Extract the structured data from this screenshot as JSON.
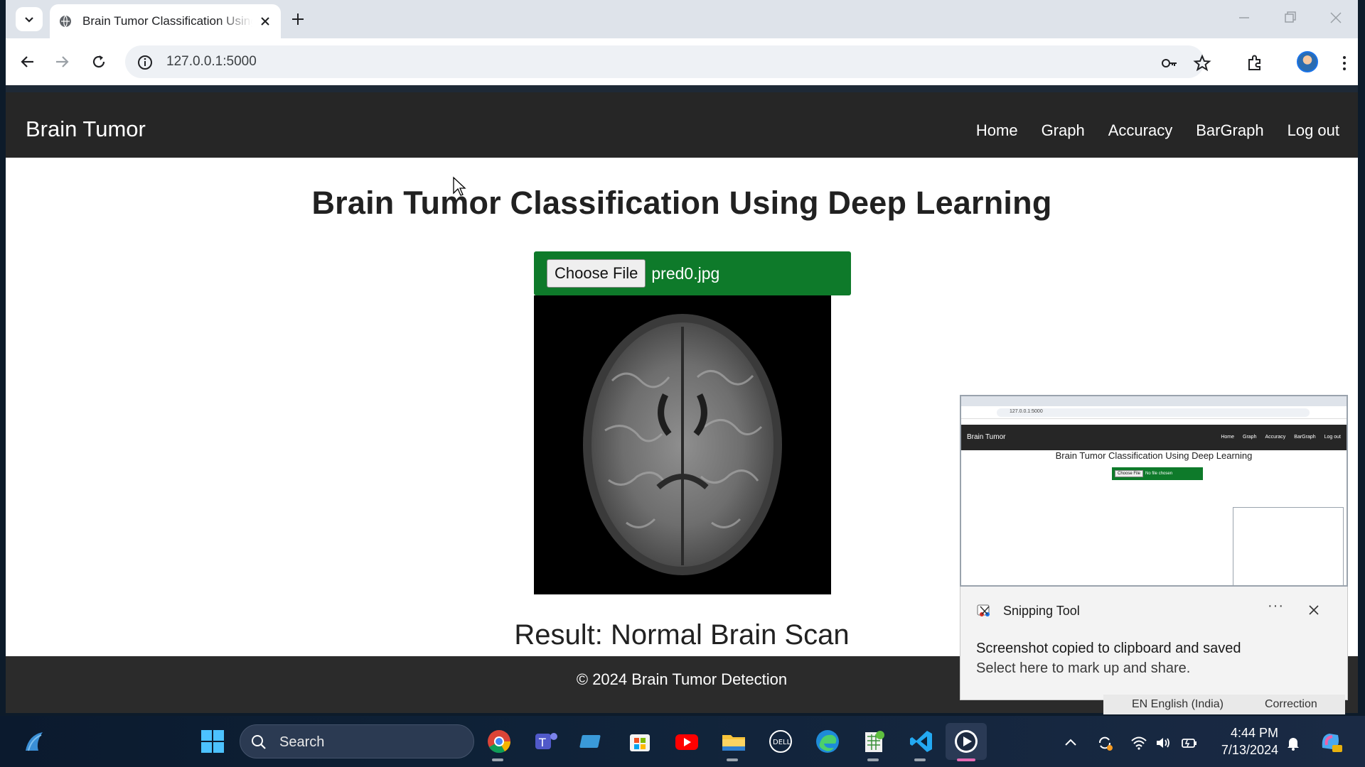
{
  "browser": {
    "tab_title": "Brain Tumor Classification Using Deep Learning",
    "url": "127.0.0.1:5000"
  },
  "site": {
    "brand": "Brain Tumor",
    "nav": [
      "Home",
      "Graph",
      "Accuracy",
      "BarGraph",
      "Log out"
    ],
    "title": "Brain Tumor Classification Using Deep Learning",
    "choose_file_label": "Choose File",
    "file_name": "pred0.jpg",
    "result": "Result: Normal Brain Scan",
    "footer": "© 2024 Brain Tumor Detection"
  },
  "toast": {
    "app_name": "Snipping Tool",
    "more": "···",
    "line1": "Screenshot copied to clipboard and saved",
    "line2": "Select here to mark up and share.",
    "preview": {
      "brand": "Brain Tumor",
      "nav": [
        "Home",
        "Graph",
        "Accuracy",
        "BarGraph",
        "Log out"
      ],
      "title": "Brain Tumor Classification Using Deep Learning",
      "choose_file_label": "Choose File",
      "file_name": "No file chosen",
      "url": "127.0.0.1:5000"
    }
  },
  "ime": {
    "language": "EN English (India)",
    "correction": "Correction"
  },
  "taskbar": {
    "search_placeholder": "Search",
    "time": "4:44 PM",
    "date": "7/13/2024"
  },
  "colors": {
    "navbar": "#262626",
    "file_box_green": "#0e7a2a",
    "footer": "#2b2b2b",
    "taskbar": "#0f2238"
  }
}
